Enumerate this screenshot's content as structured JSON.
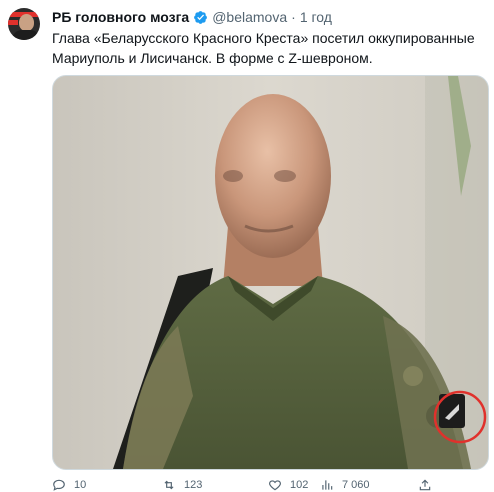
{
  "tweet": {
    "name": "РБ головного мозга",
    "handle": "@belamova",
    "separator": "·",
    "time": "1 год",
    "verified": true,
    "text": "Глава «Беларусского Красного Креста» посетил оккупированные Мариуполь и Лисичанск. В форме с Z-шевроном.",
    "media": {
      "highlight_color": "#e0312c"
    },
    "actions": {
      "reply_count": "10",
      "retweet_count": "123",
      "like_count": "102",
      "view_count": "7 060"
    }
  }
}
